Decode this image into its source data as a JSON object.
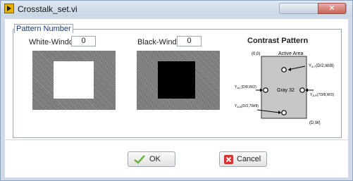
{
  "window": {
    "title": "Crosstalk_set.vi"
  },
  "group": {
    "label": "Pattern Number"
  },
  "white_window": {
    "label": "White-Window",
    "value": "0"
  },
  "black_window": {
    "label": "Black-Window",
    "value": "0"
  },
  "contrast": {
    "title": "Contrast Pattern",
    "diagram": {
      "area_label": "Active Area",
      "origin": "(0,0)",
      "center": "Gray 32",
      "corner": "(D,W)",
      "top_right": "Y",
      "top_right_sub": "A,T",
      "top_right_coord": "(D/2,W/8)",
      "left": "Y",
      "left_sub": "A,L",
      "left_coord": "(D/8,W/2)",
      "right": "Y",
      "right_sub": "A,R",
      "right_coord": "(7D/8,W/2)",
      "bottom_left": "Y",
      "bottom_left_sub": "A,B",
      "bottom_left_coord": "(D/2,7W/8)"
    }
  },
  "buttons": {
    "ok": "OK",
    "cancel": "Cancel"
  },
  "colors": {
    "title_bg": "#c9d6e4",
    "panel_bg": "#ffffff",
    "pattern_gray": "#7f7f7f",
    "ok_icon": "#6cb33f",
    "cancel_icon": "#d9332b"
  }
}
